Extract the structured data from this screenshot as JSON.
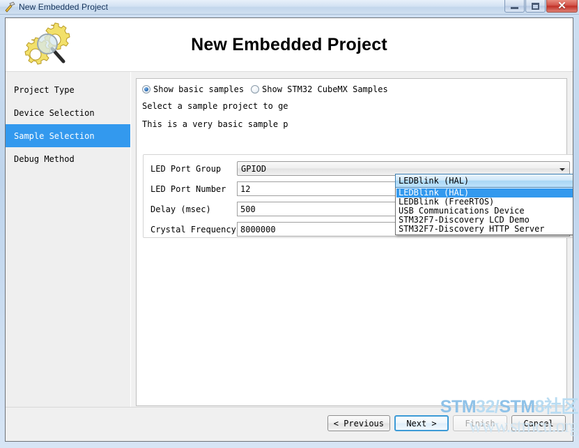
{
  "window": {
    "title": "New Embedded Project",
    "icon": "hammer-icon",
    "controls": {
      "minimize": "minimize-icon",
      "maximize": "maximize-icon",
      "close": "✕"
    }
  },
  "banner": {
    "title": "New Embedded Project",
    "icon": "gears-magnifier-icon"
  },
  "sidebar": {
    "items": [
      {
        "label": "Project Type",
        "selected": false
      },
      {
        "label": "Device Selection",
        "selected": false
      },
      {
        "label": "Sample Selection",
        "selected": true
      },
      {
        "label": "Debug Method",
        "selected": false
      }
    ],
    "selected_color": "#3399ee"
  },
  "main": {
    "radios": [
      {
        "label": "Show basic samples",
        "checked": true
      },
      {
        "label": "Show STM32 CubeMX Samples",
        "checked": false
      }
    ],
    "description_line_1": "Select a sample project to ge",
    "description_line_2": "This is a very basic sample p",
    "sample_combo": {
      "value": "LEDBlink (HAL)",
      "expanded": true,
      "options": [
        "LEDBlink (HAL)",
        "LEDBlink (FreeRTOS)",
        "USB Communications Device",
        "STM32F7-Discovery LCD Demo",
        "STM32F7-Discovery HTTP Server"
      ],
      "selected_index": 0
    },
    "fields": [
      {
        "label": "LED Port Group",
        "value": "GPIOD",
        "type": "combo"
      },
      {
        "label": "LED Port Number",
        "value": "12",
        "type": "spinner"
      },
      {
        "label": "Delay (msec)",
        "value": "500",
        "type": "spinner"
      },
      {
        "label": "Crystal Frequency",
        "value": "8000000",
        "type": "spinner"
      }
    ]
  },
  "footer": {
    "buttons": [
      {
        "label": "< Previous",
        "state": "normal"
      },
      {
        "label": "Next >",
        "state": "default"
      },
      {
        "label": "Finish",
        "state": "disabled"
      },
      {
        "label": "Cancel",
        "state": "normal"
      }
    ]
  },
  "watermark": {
    "part1": "STM",
    "part2": "32/",
    "part3": "STM",
    "part4": "8社区",
    "url": "www.stmcu.org"
  }
}
